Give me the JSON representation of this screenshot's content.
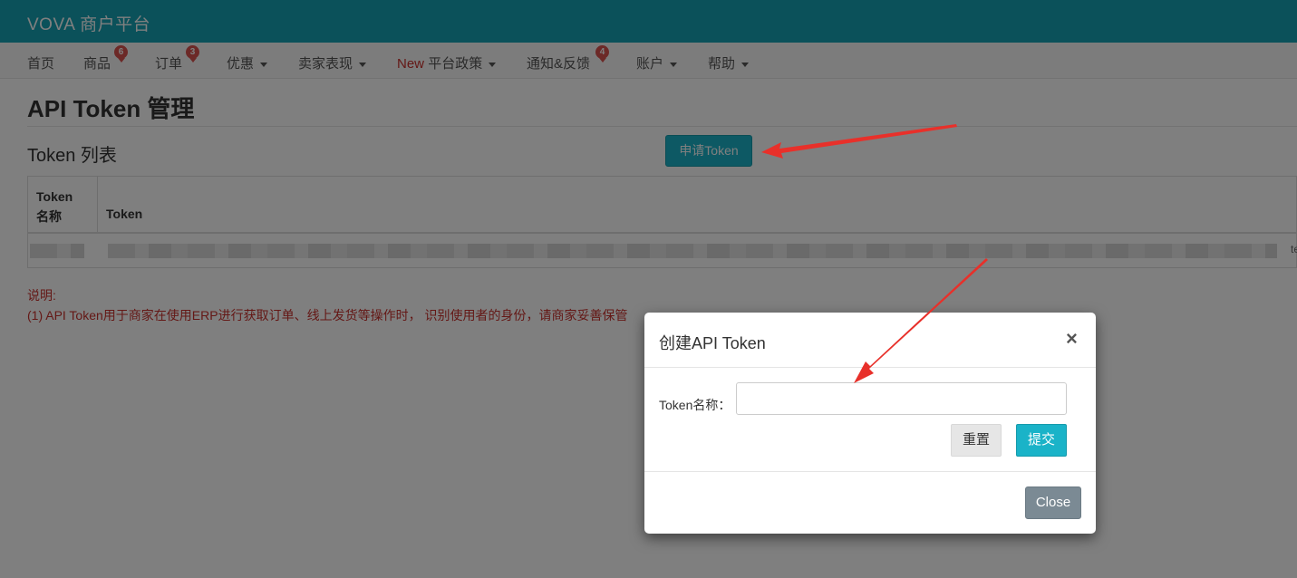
{
  "header": {
    "brand": "VOVA 商户平台"
  },
  "nav": {
    "items": [
      {
        "label": "首页"
      },
      {
        "label": "商品",
        "badge": "6"
      },
      {
        "label": "订单",
        "badge": "3"
      },
      {
        "label": "优惠"
      },
      {
        "label": "卖家表现"
      },
      {
        "prefix": "New",
        "label": "平台政策"
      },
      {
        "label": "通知&反馈",
        "badge": "4"
      },
      {
        "label": "账户"
      },
      {
        "label": "帮助"
      }
    ]
  },
  "page": {
    "title": "API Token 管理",
    "list_title": "Token 列表",
    "apply_button": "申请Token"
  },
  "table": {
    "headers": [
      "Token\n名称",
      "Token"
    ],
    "row_tail": "te"
  },
  "notes": {
    "title": "说明:",
    "line1": "(1) API Token用于商家在使用ERP进行获取订单、线上发货等操作时， 识别使用者的身份，请商家妥善保管"
  },
  "modal": {
    "title": "创建API Token",
    "close_icon": "×",
    "field_label": "Token名称：",
    "field_value": "",
    "reset_button": "重置",
    "submit_button": "提交",
    "close_button": "Close"
  },
  "colors": {
    "header_bg": "#16a3b4",
    "primary_button": "#1ab3c8",
    "note_text": "#c9302c",
    "badge": "#d9534f",
    "arrow": "#e8302a"
  }
}
